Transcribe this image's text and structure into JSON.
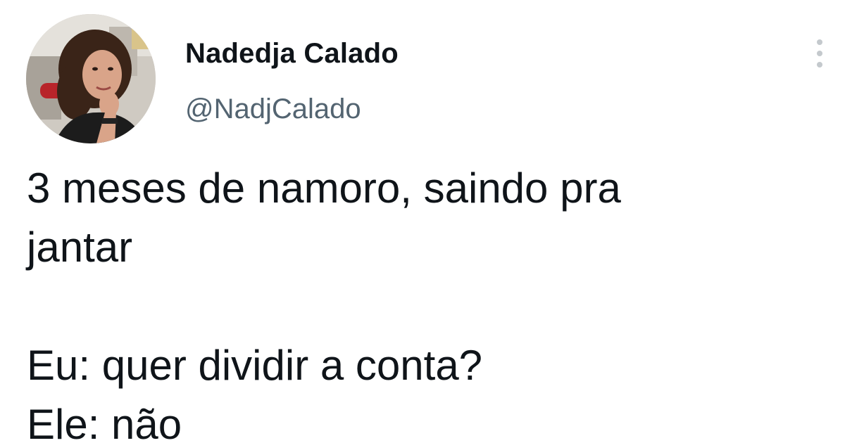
{
  "author": {
    "display_name": "Nadedja Calado",
    "handle": "@NadjCalado",
    "avatar_icon": "profile-photo"
  },
  "more_icon": "vertical-ellipsis-icon",
  "tweet": {
    "lines": [
      "3 meses de namoro, saindo pra",
      "jantar",
      "",
      "Eu: quer dividir a conta?",
      "Ele: não"
    ]
  },
  "colors": {
    "background": "#ffffff",
    "text_primary": "#0f1419",
    "text_secondary": "#536471",
    "icon_muted": "#c4c9cd"
  }
}
